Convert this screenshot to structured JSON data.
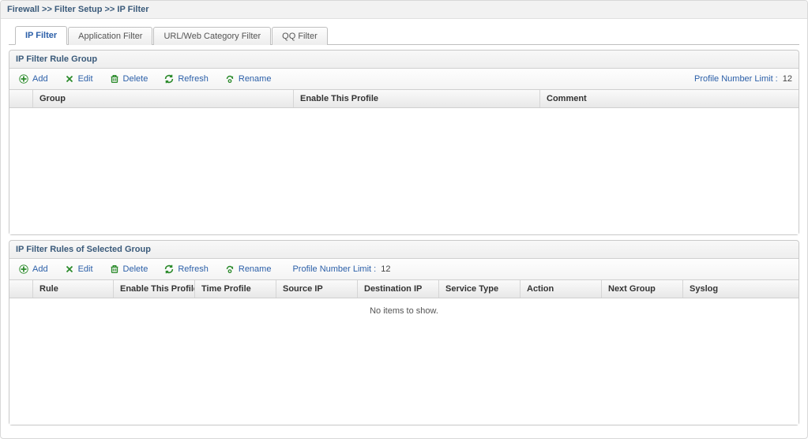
{
  "breadcrumb": "Firewall >> Filter Setup >> IP Filter",
  "tabs": [
    {
      "label": "IP Filter",
      "active": true
    },
    {
      "label": "Application Filter",
      "active": false
    },
    {
      "label": "URL/Web Category Filter",
      "active": false
    },
    {
      "label": "QQ Filter",
      "active": false
    }
  ],
  "group_panel": {
    "title": "IP Filter Rule Group",
    "toolbar": {
      "add": "Add",
      "edit": "Edit",
      "delete": "Delete",
      "refresh": "Refresh",
      "rename": "Rename",
      "profile_limit_label": "Profile Number Limit :",
      "profile_limit_value": "12"
    },
    "columns": {
      "group": "Group",
      "enable": "Enable This Profile",
      "comment": "Comment"
    }
  },
  "rules_panel": {
    "title": "IP Filter Rules of Selected Group",
    "toolbar": {
      "add": "Add",
      "edit": "Edit",
      "delete": "Delete",
      "refresh": "Refresh",
      "rename": "Rename",
      "profile_limit_label": "Profile Number Limit :",
      "profile_limit_value": "12"
    },
    "columns": {
      "rule": "Rule",
      "enable": "Enable This Profile",
      "time": "Time Profile",
      "src": "Source IP",
      "dst": "Destination IP",
      "svc": "Service Type",
      "action": "Action",
      "next": "Next Group",
      "syslog": "Syslog"
    },
    "empty": "No items to show."
  }
}
